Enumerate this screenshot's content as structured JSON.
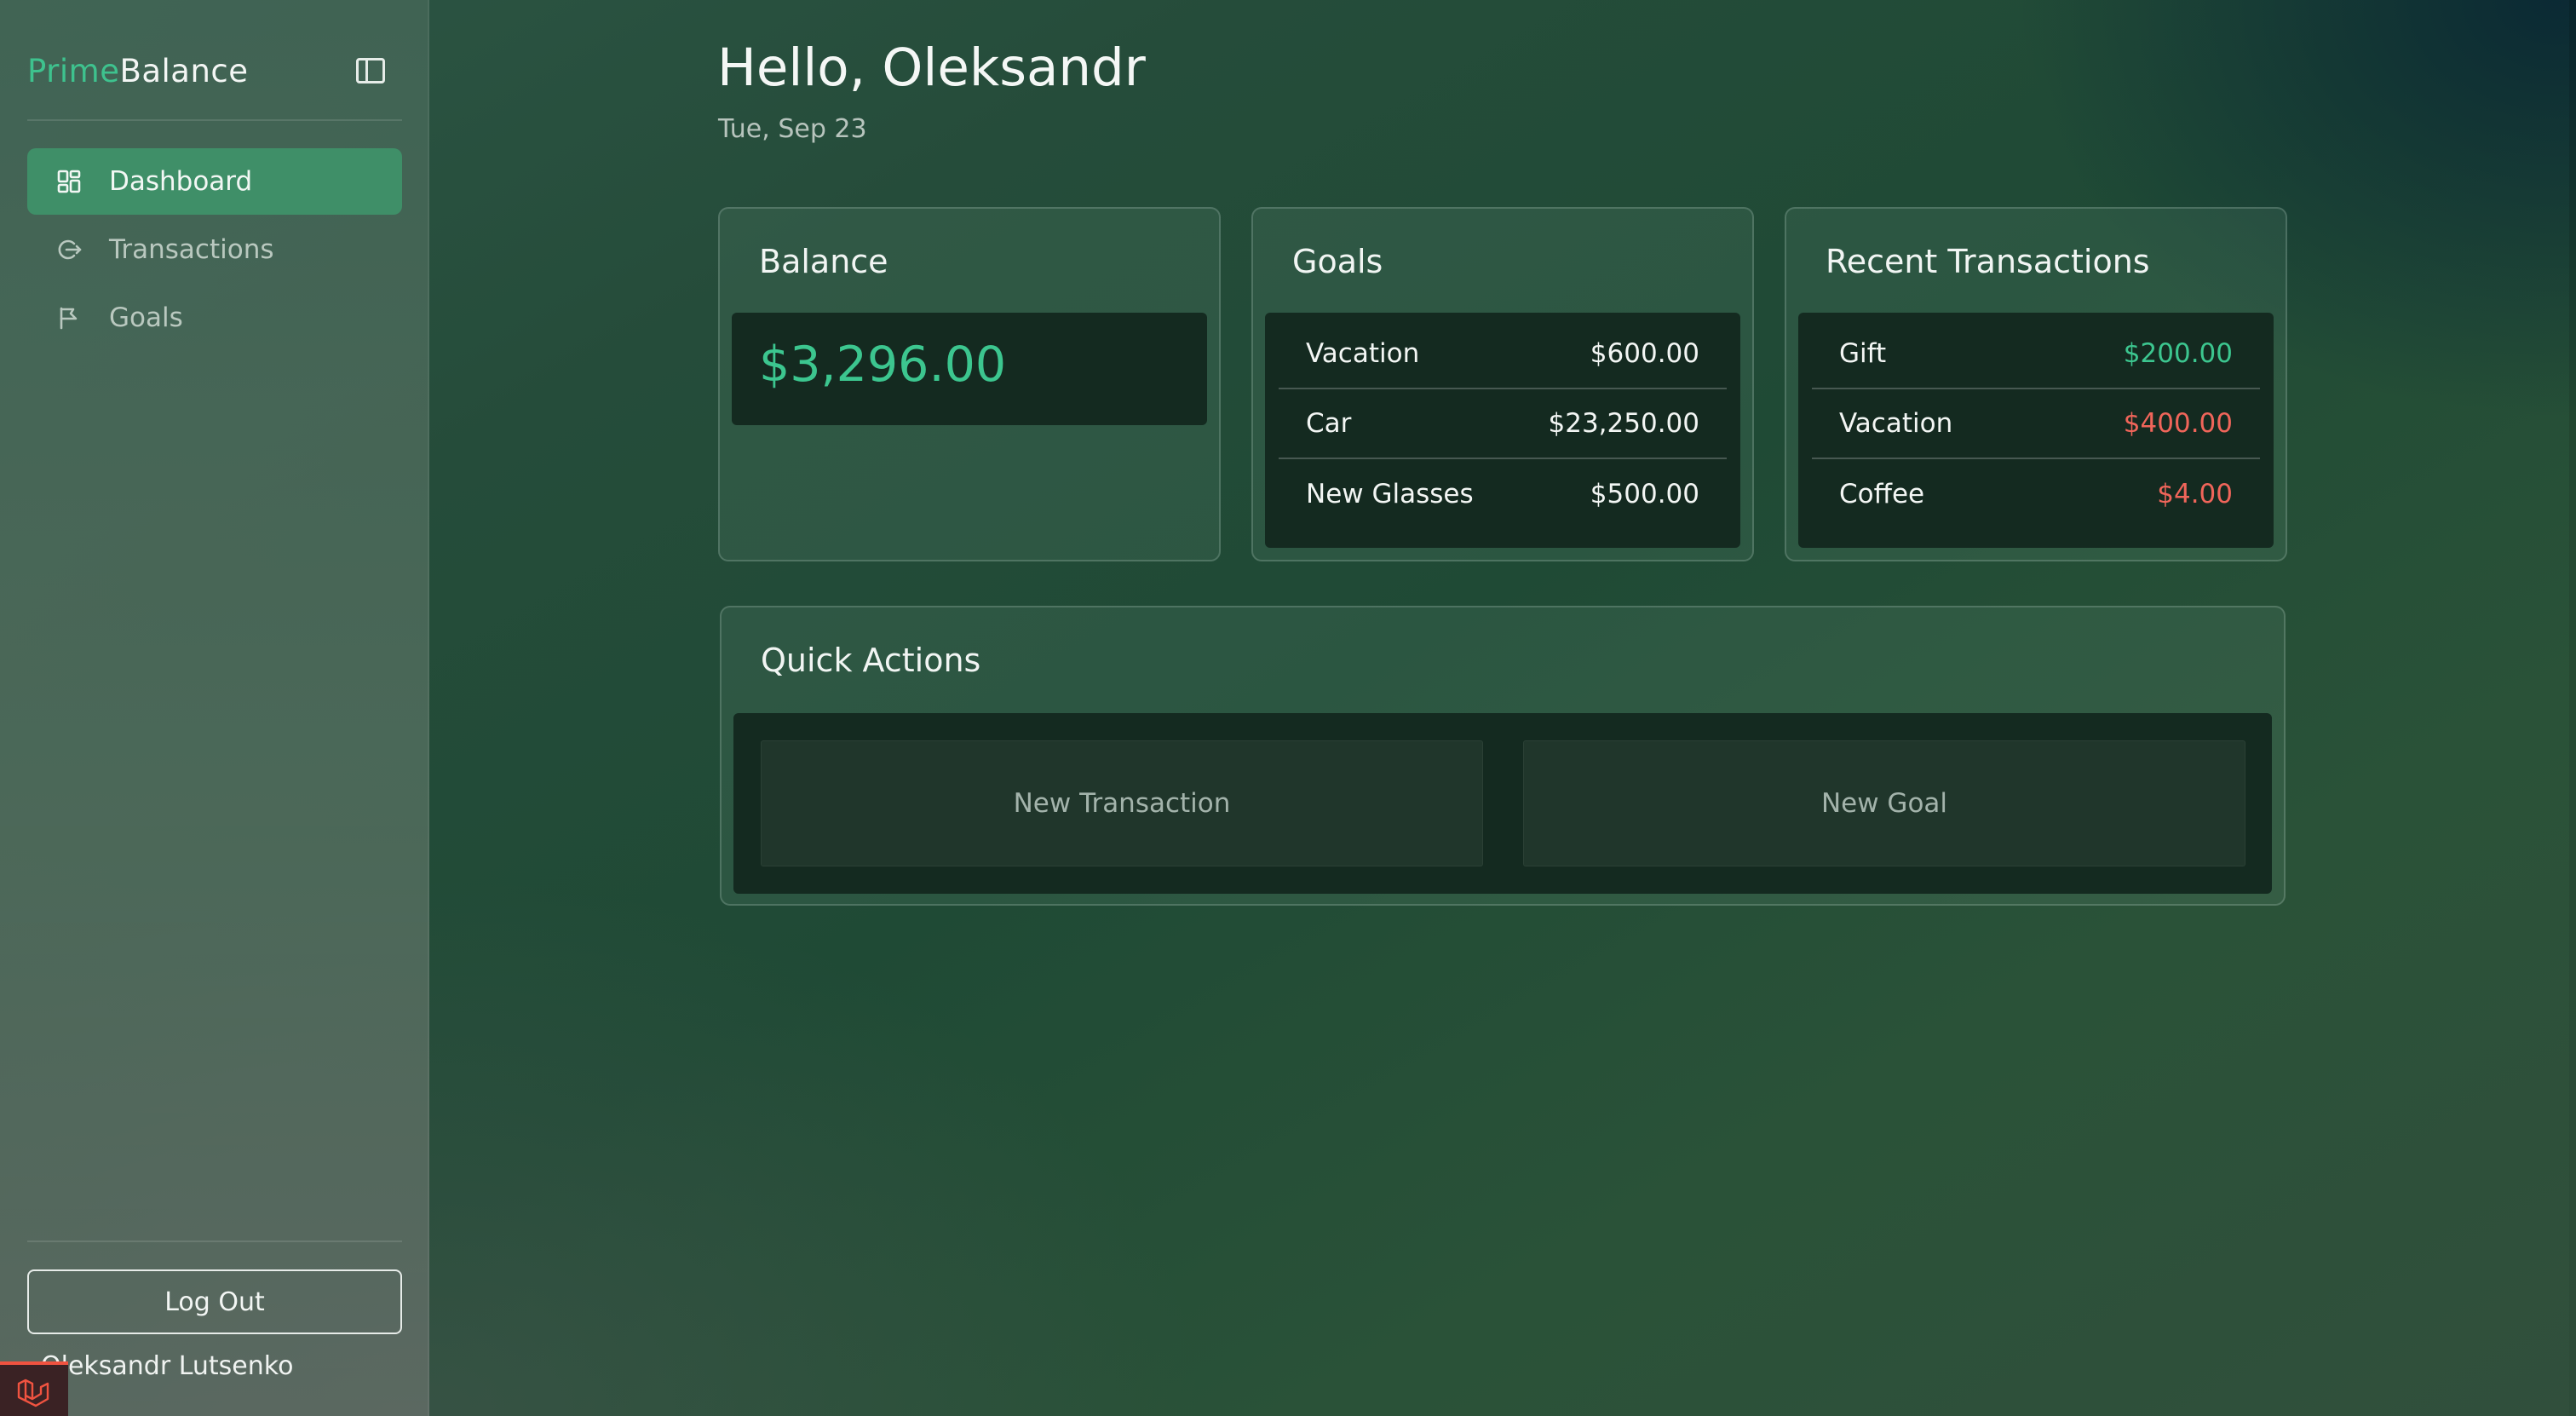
{
  "sidebar": {
    "brand_prime": "Prime",
    "brand_balance": "Balance",
    "nav": [
      {
        "label": "Dashboard",
        "icon": "dashboard-grid-icon",
        "active": true
      },
      {
        "label": "Transactions",
        "icon": "transactions-arrows-icon",
        "active": false
      },
      {
        "label": "Goals",
        "icon": "flag-icon",
        "active": false
      }
    ],
    "logout_label": "Log Out",
    "user_name": "Oleksandr Lutsenko"
  },
  "header": {
    "greeting": "Hello, Oleksandr",
    "date": "Tue, Sep 23"
  },
  "balance_card": {
    "title": "Balance",
    "amount": "$3,296.00"
  },
  "goals_card": {
    "title": "Goals",
    "items": [
      {
        "name": "Vacation",
        "amount": "$600.00"
      },
      {
        "name": "Car",
        "amount": "$23,250.00"
      },
      {
        "name": "New Glasses",
        "amount": "$500.00"
      }
    ]
  },
  "transactions_card": {
    "title": "Recent Transactions",
    "items": [
      {
        "name": "Gift",
        "amount": "$200.00",
        "type": "income"
      },
      {
        "name": "Vacation",
        "amount": "$400.00",
        "type": "expense"
      },
      {
        "name": "Coffee",
        "amount": "$4.00",
        "type": "expense"
      }
    ]
  },
  "quick_actions": {
    "title": "Quick Actions",
    "new_transaction_label": "New Transaction",
    "new_goal_label": "New Goal"
  },
  "colors": {
    "accent": "#3ec28e",
    "active_nav": "#3f8f68",
    "income": "#3cc68f",
    "expense": "#f0655a"
  }
}
